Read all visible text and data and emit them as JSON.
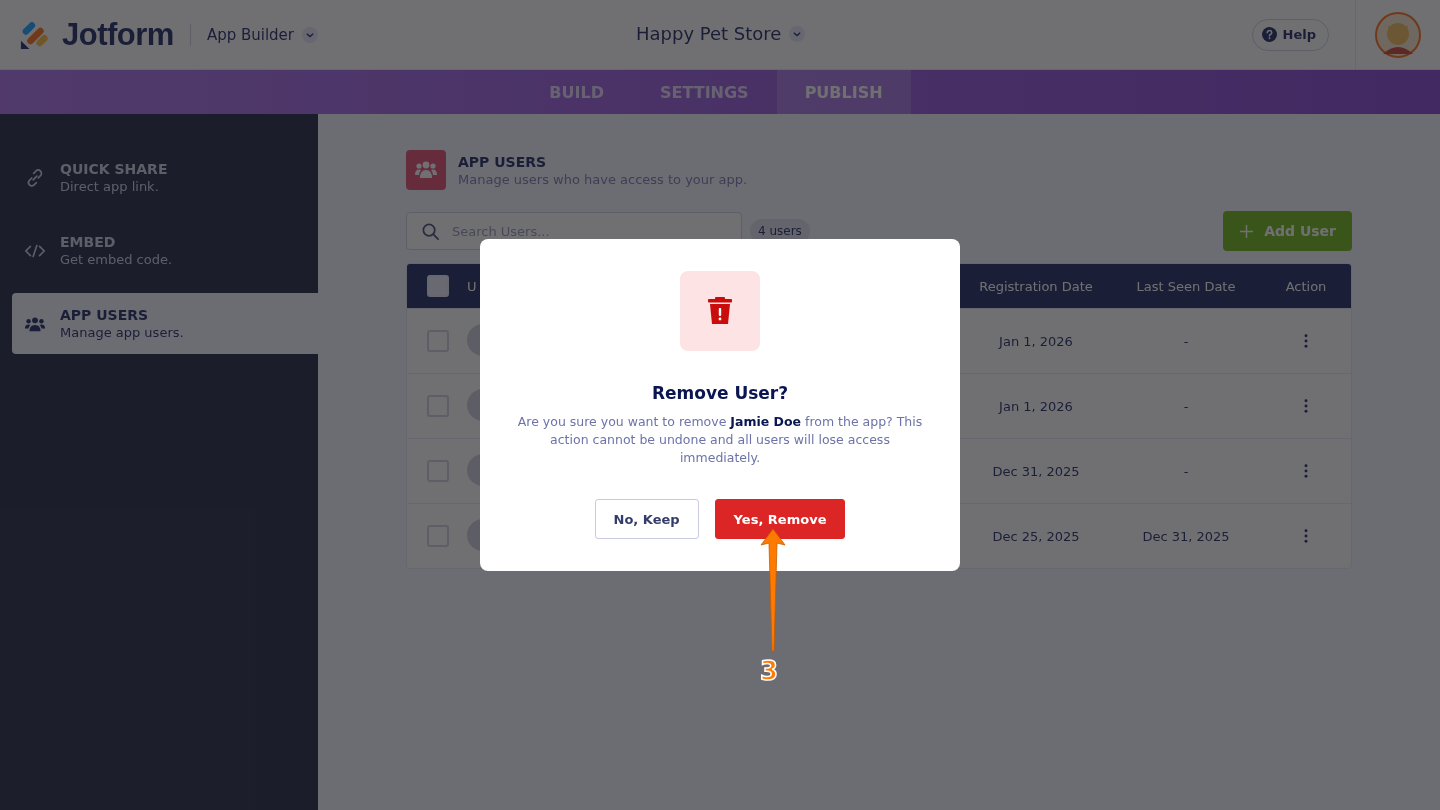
{
  "header": {
    "logo": "Jotform",
    "product": "App Builder",
    "app_name": "Happy Pet Store",
    "help": "Help"
  },
  "tabs": [
    {
      "label": "BUILD",
      "selected": false
    },
    {
      "label": "SETTINGS",
      "selected": false
    },
    {
      "label": "PUBLISH",
      "selected": true
    }
  ],
  "sidebar": {
    "items": [
      {
        "kind": "link",
        "title": "QUICK SHARE",
        "subtitle": "Direct app link.",
        "selected": false
      },
      {
        "kind": "code",
        "title": "EMBED",
        "subtitle": "Get embed code.",
        "selected": false
      },
      {
        "kind": "users",
        "title": "APP USERS",
        "subtitle": "Manage app users.",
        "selected": true
      }
    ]
  },
  "section": {
    "title": "APP USERS",
    "subtitle": "Manage users who have access to your app."
  },
  "search": {
    "placeholder": "Search Users..."
  },
  "user_count": "4 users",
  "add_button": "Add User",
  "table": {
    "header_checked": false,
    "columns": [
      "U",
      "Registration Date",
      "Last Seen Date",
      "Action"
    ],
    "rows": [
      {
        "checked": false,
        "registration_date": "Jan 1, 2026",
        "last_seen_date": "-"
      },
      {
        "checked": false,
        "registration_date": "Jan 1, 2026",
        "last_seen_date": "-"
      },
      {
        "checked": false,
        "registration_date": "Dec 31, 2025",
        "last_seen_date": "-"
      },
      {
        "checked": false,
        "registration_date": "Dec 25, 2025",
        "last_seen_date": "Dec 31, 2025"
      }
    ]
  },
  "dialog": {
    "title": "Remove User?",
    "message": "Are you sure you want to remove **Jamie Doe** from the app? This action cannot be undone and all users will lose access immediately.",
    "buttons": [
      {
        "kind": "secondary",
        "label": "No, Keep"
      },
      {
        "kind": "danger",
        "label": "Yes, Remove"
      }
    ]
  },
  "annotation": {
    "step": "3"
  }
}
